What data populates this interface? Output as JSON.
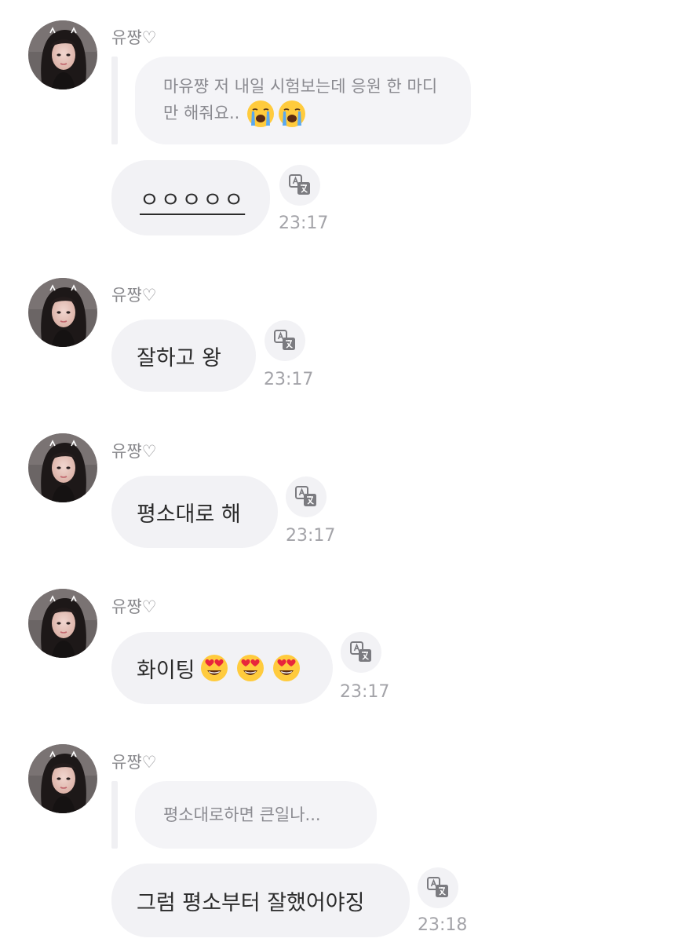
{
  "messages": [
    {
      "sender": "유쨩♡",
      "quoted": "마유쨩 저 내일 시험보는데 응원 한 마디만 해줘요..",
      "quoted_emojis": [
        "loudly-crying-face",
        "loudly-crying-face"
      ],
      "text": "ㅇㅇㅇㅇㅇ",
      "time": "23:17"
    },
    {
      "sender": "유쨩♡",
      "text": "잘하고 왕",
      "time": "23:17"
    },
    {
      "sender": "유쨩♡",
      "text": "평소대로 해",
      "time": "23:17"
    },
    {
      "sender": "유쨩♡",
      "text": "화이팅",
      "text_emojis": [
        "heart-eyes-face",
        "heart-eyes-face",
        "heart-eyes-face"
      ],
      "time": "23:17"
    },
    {
      "sender": "유쨩♡",
      "quoted": "평소대로하면 큰일나...",
      "text": "그럼 평소부터 잘했어야징",
      "time": "23:18"
    }
  ],
  "icons": {
    "translate": "translate-icon"
  },
  "colors": {
    "bubble": "#f2f2f5",
    "sender": "#8a8a8e",
    "time": "#a3a3a8",
    "text": "#2b2b2b"
  }
}
